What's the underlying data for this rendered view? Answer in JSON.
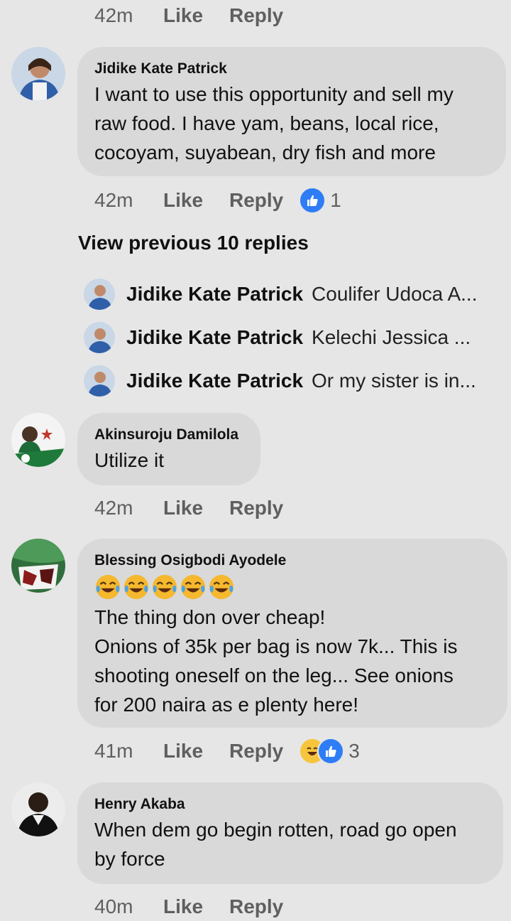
{
  "top_meta": {
    "time": "42m",
    "like": "Like",
    "reply": "Reply"
  },
  "comments": [
    {
      "name": "Jidike Kate Patrick",
      "text": "I want to use this opportunity and sell my\nraw food. I have yam, beans, local rice,\ncocoyam, suyabean, dry fish and more",
      "time": "42m",
      "like": "Like",
      "reply": "Reply",
      "reaction_count": "1"
    },
    {
      "name": "Akinsuroju Damilola",
      "text": "Utilize it",
      "time": "42m",
      "like": "Like",
      "reply": "Reply"
    },
    {
      "name": "Blessing Osigbodi Ayodele",
      "text": "The thing don over cheap!\nOnions of 35k per bag is now 7k... This is\nshooting oneself on the leg... See onions\nfor 200 naira as e plenty here!",
      "time": "41m",
      "like": "Like",
      "reply": "Reply",
      "reaction_count": "3"
    },
    {
      "name": "Henry Akaba",
      "text": "When dem go begin rotten, road go open\nby force",
      "time": "40m",
      "like": "Like",
      "reply": "Reply"
    }
  ],
  "view_previous": "View previous 10 replies",
  "replies": [
    {
      "name": "Jidike Kate Patrick",
      "text": "Coulifer Udoca A..."
    },
    {
      "name": "Jidike Kate Patrick",
      "text": "Kelechi Jessica ..."
    },
    {
      "name": "Jidike Kate Patrick",
      "text": "Or my sister is in..."
    }
  ],
  "colors": {
    "background": "#e6e6e6",
    "bubble": "#d9d9d9",
    "like_blue": "#2f7df6",
    "haha_yellow": "#f7c53d"
  }
}
